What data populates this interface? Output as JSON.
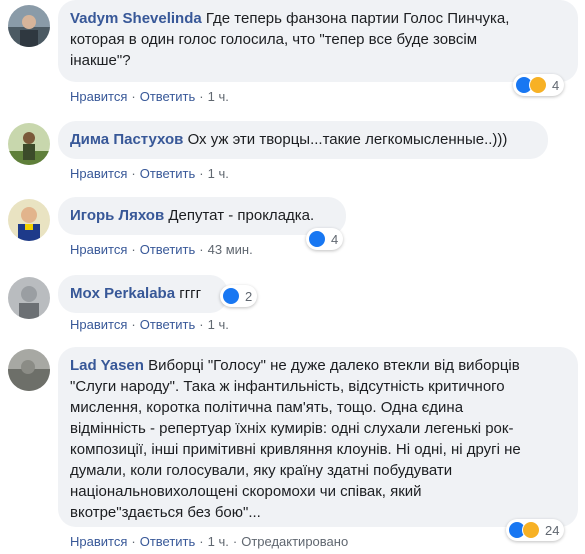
{
  "comments": [
    {
      "author": "Vadym Shevelinda",
      "text_lines": [
        "Где теперь фанзона партии Голос Пинчука,",
        "которая в один голос голосила, что \"тепер все буде зовсім",
        "інакше\"?"
      ],
      "reactions": {
        "count": "4",
        "types": [
          "like-icon",
          "haha-icon"
        ]
      },
      "actions": {
        "like": "Нравится",
        "reply": "Ответить",
        "time": "1 ч."
      }
    },
    {
      "author": "Дима Пастухов",
      "text": "Ох уж эти творцы...такие легкомысленные..)))",
      "actions": {
        "like": "Нравится",
        "reply": "Ответить",
        "time": "1 ч."
      }
    },
    {
      "author": "Игорь Ляхов",
      "text": "Депутат - прокладка.",
      "reactions": {
        "count": "4",
        "types": [
          "like-icon"
        ]
      },
      "actions": {
        "like": "Нравится",
        "reply": "Ответить",
        "time": "43 мин."
      }
    },
    {
      "author": "Mox Perkalaba",
      "text": "гггг",
      "reactions": {
        "count": "2",
        "types": [
          "like-icon"
        ]
      },
      "actions": {
        "like": "Нравится",
        "reply": "Ответить",
        "time": "1 ч."
      }
    },
    {
      "author": "Lad Yasen",
      "text_lines": [
        "Виборці \"Голосу\" не дуже далеко втекли від виборців",
        "\"Слуги народу\". Така ж інфантильність, відсутність критичного",
        "мислення, коротка політична пам'ять, тощо. Одна єдина",
        "відмінність - репертуар їхніх кумирів: одні слухали легенькі рок-",
        "композиції, інші примітивні кривляння клоунів. Ні одні, ні другі не",
        "думали, коли голосували, яку країну здатні побудувати",
        "національновихолощені скоромохи чи співак, який",
        "вкотре\"здається без бою\"..."
      ],
      "reactions": {
        "count": "24",
        "types": [
          "like-icon",
          "haha-icon"
        ]
      },
      "actions": {
        "like": "Нравится",
        "reply": "Ответить",
        "time": "1 ч.",
        "edited": "Отредактировано"
      }
    }
  ],
  "colors": {
    "link": "#385898",
    "bubble": "#f0f2f5",
    "like": "#1877f2",
    "haha": "#f7b125"
  }
}
